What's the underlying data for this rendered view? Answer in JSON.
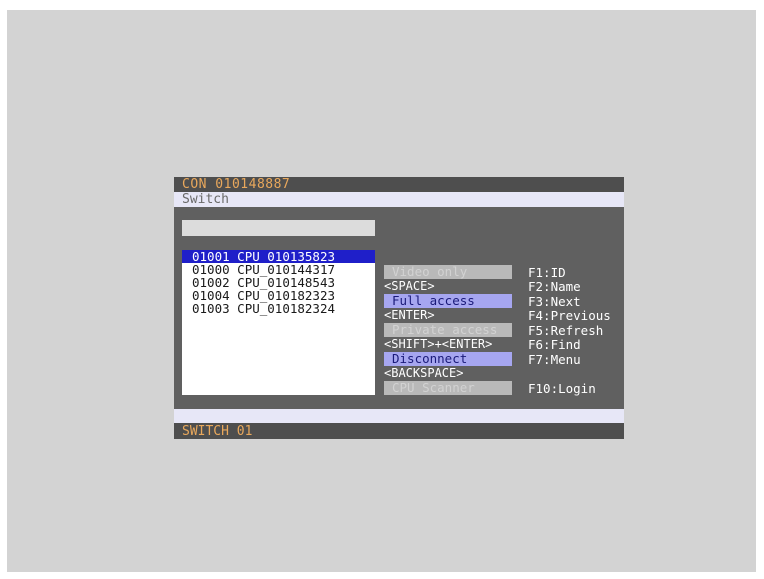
{
  "header": {
    "console_id": "CON 010148887"
  },
  "title": "Switch",
  "search": {
    "value": "",
    "placeholder": ""
  },
  "cpu_list": [
    {
      "id": "01001",
      "name": "CPU_010135823",
      "selected": true
    },
    {
      "id": "01000",
      "name": "CPU_010144317",
      "selected": false
    },
    {
      "id": "01002",
      "name": "CPU_010148543",
      "selected": false
    },
    {
      "id": "01004",
      "name": "CPU_010182323",
      "selected": false
    },
    {
      "id": "01003",
      "name": "CPU_010182324",
      "selected": false
    }
  ],
  "actions": {
    "video_only": {
      "label": "Video only",
      "enabled": false
    },
    "space_hint": "<SPACE>",
    "full_access": {
      "label": "Full access",
      "enabled": true
    },
    "enter_hint": "<ENTER>",
    "private_access": {
      "label": "Private access",
      "enabled": false
    },
    "shift_enter_hint": "<SHIFT>+<ENTER>",
    "disconnect": {
      "label": "Disconnect",
      "enabled": true
    },
    "backspace_hint": "<BACKSPACE>",
    "cpu_scanner": {
      "label": "CPU Scanner",
      "enabled": false
    }
  },
  "function_keys": {
    "f1": "F1:ID",
    "f2": "F2:Name",
    "f3": "F3:Next",
    "f4": "F4:Previous",
    "f5": "F5:Refresh",
    "f6": "F6:Find",
    "f7": "F7:Menu",
    "f10": "F10:Login"
  },
  "status": {
    "switch_name": "SWITCH 01"
  },
  "colors": {
    "accent_orange": "#e9a85c",
    "selection_blue": "#1f1fc9",
    "active_button": "#a6a6f0",
    "panel_gray": "#606060"
  }
}
